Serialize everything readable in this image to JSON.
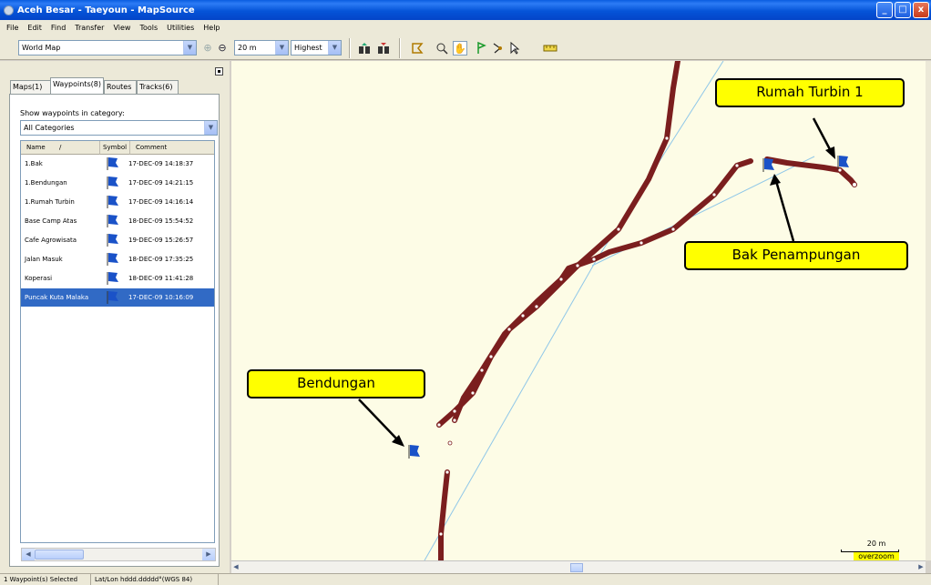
{
  "window": {
    "title": "Aceh Besar - Taeyoun - MapSource",
    "controls": [
      "_",
      "□",
      "x"
    ]
  },
  "menu": [
    "File",
    "Edit",
    "Find",
    "Transfer",
    "View",
    "Tools",
    "Utilities",
    "Help"
  ],
  "toolbar": {
    "map_product": "World Map",
    "zoom_level": "20 m",
    "detail_level": "Highest"
  },
  "tabs": [
    "Maps(1)",
    "Waypoints(8)",
    "Routes",
    "Tracks(6)"
  ],
  "active_tab": "Waypoints(8)",
  "waypoints_panel": {
    "category_label": "Show waypoints in category:",
    "category_value": "All Categories",
    "columns": [
      "Name",
      "Symbol",
      "Comment"
    ],
    "rows": [
      {
        "name": "1.Bak",
        "comment": "17-DEC-09 14:18:37"
      },
      {
        "name": "1.Bendungan",
        "comment": "17-DEC-09 14:21:15"
      },
      {
        "name": "1.Rumah Turbin",
        "comment": "17-DEC-09 14:16:14"
      },
      {
        "name": "Base Camp Atas",
        "comment": "18-DEC-09 15:54:52"
      },
      {
        "name": "Cafe Agrowisata",
        "comment": "19-DEC-09 15:26:57"
      },
      {
        "name": "Jalan Masuk",
        "comment": "18-DEC-09 17:35:25"
      },
      {
        "name": "Koperasi",
        "comment": "18-DEC-09 11:41:28"
      },
      {
        "name": "Puncak Kuta Malaka",
        "comment": "17-DEC-09 10:16:09",
        "selected": true
      }
    ]
  },
  "map": {
    "labels": {
      "rumah_turbin": "Rumah Turbin 1",
      "bak": "Bak Penampungan",
      "bendungan": "Bendungan"
    },
    "scale": "20 m",
    "overzoom": "overzoom",
    "track_color": "#7b1e1e",
    "background": "#fdfce6"
  },
  "status": {
    "selection": "1 Waypoint(s) Selected",
    "position": "Lat/Lon hddd.ddddd°(WGS 84)"
  }
}
